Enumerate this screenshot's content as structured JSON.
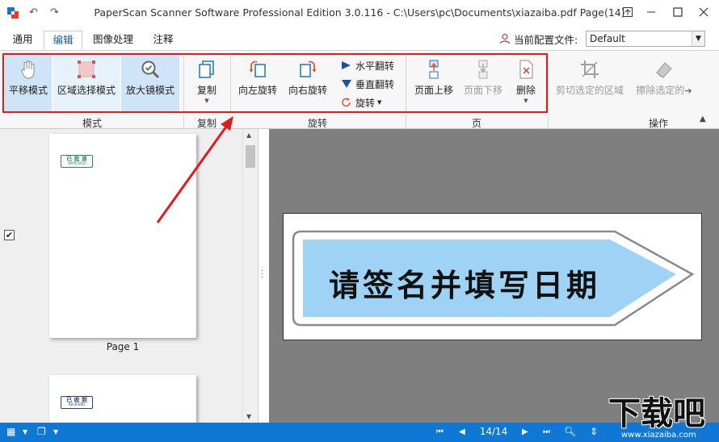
{
  "window": {
    "title": "PaperScan Scanner Software Professional Edition 3.0.116 - C:\\Users\\pc\\Documents\\xiazaiba.pdf Page(14)",
    "undo_icon": "undo-icon",
    "redo_icon": "redo-icon"
  },
  "tabs": [
    {
      "label": "通用"
    },
    {
      "label": "编辑"
    },
    {
      "label": "图像处理"
    },
    {
      "label": "注释"
    }
  ],
  "config": {
    "label": "当前配置文件:",
    "value": "Default"
  },
  "ribbon": {
    "mode": {
      "group_label": "模式",
      "pan": "平移模式",
      "area_select": "区域选择模式",
      "magnifier": "放大镜模式"
    },
    "copy": {
      "group_label": "复制",
      "copy": "复制"
    },
    "rotate": {
      "group_label": "旋转",
      "rotate_left": "向左旋转",
      "rotate_right": "向右旋转",
      "flip_horizontal": "水平翻转",
      "flip_vertical": "垂直翻转",
      "rotate": "旋转"
    },
    "page": {
      "group_label": "页",
      "page_up": "页面上移",
      "page_down": "页面下移",
      "delete": "删除"
    },
    "actions": {
      "group_label": "操作",
      "crop": "剪切选定的区域",
      "erase": "擦除选定的"
    }
  },
  "thumbnails": [
    {
      "label": "Page 1",
      "stamp_text": "已 批 准",
      "stamp_color": "#2e8b57",
      "checked": "✔"
    },
    {
      "label": "",
      "stamp_text": "已 收 到",
      "stamp_color": "#2c3f7a"
    }
  ],
  "document": {
    "sign_text": "请签名并填写日期",
    "sign_fill": "#9fd3f5"
  },
  "statusbar": {
    "page_indicator": "14/14"
  },
  "watermark": {
    "main": "下载吧",
    "sub": "www.xiazaiba.com"
  },
  "colors": {
    "statusbar_bg": "#0f78d4",
    "highlight": "#e01b1b",
    "selected_button": "#cfe4f7"
  }
}
